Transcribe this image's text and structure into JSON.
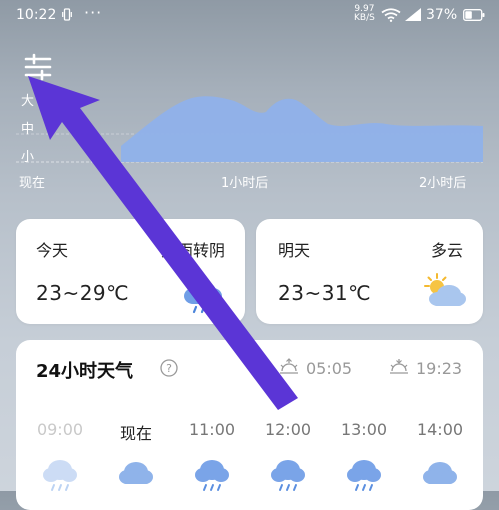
{
  "status_bar": {
    "time": "10:22",
    "dots": "···",
    "net_speed_value": "9.97",
    "net_speed_unit": "KB/S",
    "battery": "37%"
  },
  "precip_chart": {
    "levels": [
      "大",
      "中",
      "小"
    ],
    "times": [
      "现在",
      "1小时后",
      "2小时后"
    ]
  },
  "today": {
    "day": "今天",
    "condition": "大雨转阴",
    "temp": "23~29℃",
    "icon": "rain-cloud-icon"
  },
  "tomorrow": {
    "day": "明天",
    "condition": "多云",
    "temp": "23~31℃",
    "icon": "partly-cloudy-icon"
  },
  "hourly": {
    "title": "24小时天气",
    "sunrise": "05:05",
    "sunset": "19:23",
    "hours": [
      "09:00",
      "现在",
      "11:00",
      "12:00",
      "13:00",
      "14:00"
    ]
  },
  "colors": {
    "chart_fill": "#8fb1ea",
    "arrow": "#5b35d6"
  }
}
